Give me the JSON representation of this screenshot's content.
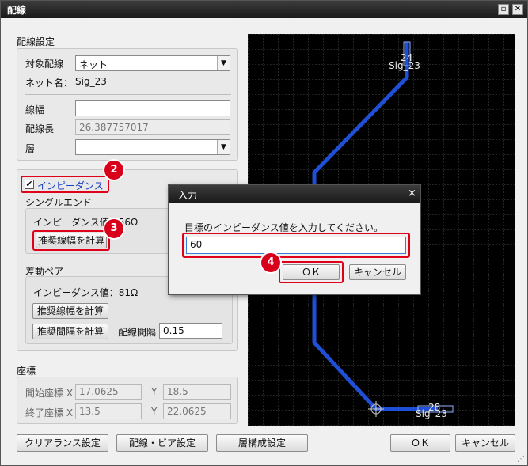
{
  "window": {
    "title": "配線",
    "restore_glyph": "▫",
    "close_glyph": "✕"
  },
  "wiring": {
    "group_label": "配線設定",
    "target_label": "対象配線",
    "target_value": "ネット",
    "net_label": "ネット名：",
    "net_value": "Sig_23",
    "width_label": "線幅",
    "width_value": "",
    "length_label": "配線長",
    "length_value": "26.387757017",
    "layer_label": "層",
    "layer_value": ""
  },
  "impedance": {
    "checkbox_label": "インピーダンス",
    "single_label": "シングルエンド",
    "single_value_label": "インピーダンス値：56Ω",
    "single_calc_button": "推奨線幅を計算",
    "diff_label": "差動ペア",
    "diff_value_label": "インピーダンス値：81Ω",
    "diff_calc_width_button": "推奨線幅を計算",
    "diff_calc_gap_button": "推奨間隔を計算",
    "diff_gap_label": "配線間隔",
    "diff_gap_value": "0.15"
  },
  "coords": {
    "group_label": "座標",
    "start_x_label": "開始座標 X",
    "start_x": "17.0625",
    "start_y_label": "Y",
    "start_y": "18.5",
    "end_x_label": "終了座標 X",
    "end_x": "13.5",
    "end_y_label": "Y",
    "end_y": "22.0625"
  },
  "bottom_buttons": {
    "clearance": "クリアランス設定",
    "via": "配線・ビア設定",
    "layer_config": "層構成設定",
    "ok": "ＯＫ",
    "cancel": "キャンセル"
  },
  "canvas": {
    "top_pin": "24",
    "top_net": "Sig_23",
    "bottom_pin": "28",
    "bottom_net": "Sig_23",
    "trace_color": "#1f4fd6",
    "grid_color": "#5a5a5a"
  },
  "dialog": {
    "title": "入力",
    "close_glyph": "×",
    "prompt": "目標のインピーダンス値を入力してください。",
    "value": "60",
    "ok": "ＯＫ",
    "cancel": "キャンセル"
  },
  "badges": {
    "b2": "2",
    "b3": "3",
    "b4": "4"
  },
  "accent": "#e0001a"
}
